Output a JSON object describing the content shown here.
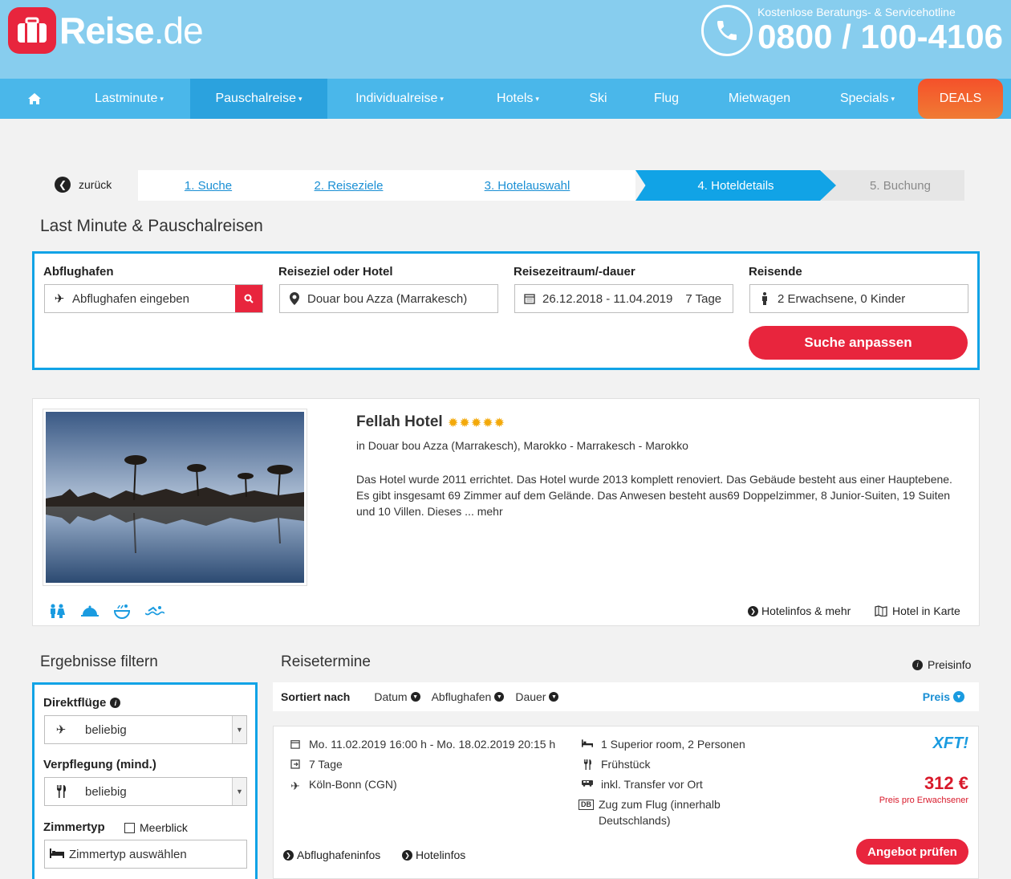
{
  "brand": {
    "name": "Reise",
    "tld": ".de",
    "red": "#e8253d",
    "blue": "#11a3e6",
    "header_blue": "#87cdee"
  },
  "hotline": {
    "label": "Kostenlose Beratungs- & Servicehotline",
    "number": "0800 / 100-4106"
  },
  "nav": {
    "items": [
      {
        "label": "Lastminute",
        "caret": "▾"
      },
      {
        "label": "Pauschalreise",
        "caret": "▾"
      },
      {
        "label": "Individualreise",
        "caret": "▾"
      },
      {
        "label": "Hotels",
        "caret": "▾"
      },
      {
        "label": "Ski",
        "caret": ""
      },
      {
        "label": "Flug",
        "caret": ""
      },
      {
        "label": "Mietwagen",
        "caret": ""
      },
      {
        "label": "Specials",
        "caret": "▾"
      }
    ],
    "active": "Pauschalreise",
    "deals": "DEALS"
  },
  "steps": {
    "back": "zurück",
    "items": [
      "1. Suche",
      "2. Reiseziele",
      "3. Hotelauswahl",
      "4. Hoteldetails",
      "5. Buchung"
    ],
    "current": "4. Hoteldetails"
  },
  "search": {
    "title": "Last Minute & Pauschalreisen",
    "departure_label": "Abflughafen",
    "departure_placeholder": "Abflughafen eingeben",
    "destination_label": "Reiseziel oder Hotel",
    "destination_value": "Douar bou Azza (Marrakesch)",
    "period_label": "Reisezeitraum/-dauer",
    "period_value": "26.12.2018 - 11.04.2019",
    "period_duration": "7 Tage",
    "travelers_label": "Reisende",
    "travelers_value": "2 Erwachsene, 0 Kinder",
    "submit": "Suche anpassen"
  },
  "hotel": {
    "name": "Fellah Hotel",
    "stars": 5,
    "location": "in Douar bou Azza (Marrakesch), Marokko - Marrakesch - Marokko",
    "description": "Das Hotel wurde 2011 errichtet. Das Hotel wurde 2013 komplett renoviert. Das Gebäude besteht aus einer Hauptebene. Es gibt insgesamt 69 Zimmer auf dem Gelände. Das Anwesen besteht aus69 Doppelzimmer, 8 Junior-Suiten, 19 Suiten und 10 Villen. Dieses ... mehr",
    "amenities": [
      "family-icon",
      "room-service-icon",
      "spa-icon",
      "swimming-icon"
    ],
    "info_link": "Hotelinfos & mehr",
    "map_link": "Hotel in Karte"
  },
  "filter": {
    "title": "Ergebnisse filtern",
    "direct_label": "Direktflüge",
    "direct_value": "beliebig",
    "board_label": "Verpflegung (mind.)",
    "board_value": "beliebig",
    "room_label": "Zimmertyp",
    "seaview_label": "Meerblick",
    "room_placeholder": "Zimmertyp auswählen"
  },
  "results": {
    "title": "Reisetermine",
    "price_info": "Preisinfo",
    "sorted_by": "Sortiert nach",
    "sort_options": [
      "Datum",
      "Abflughafen",
      "Dauer"
    ],
    "sort_active": "Preis"
  },
  "offer": {
    "dates": "Mo. 11.02.2019 16:00 h - Mo. 18.02.2019 20:15 h",
    "duration": "7 Tage",
    "airport": "Köln-Bonn (CGN)",
    "room": "1 Superior room, 2 Personen",
    "board": "Frühstück",
    "transfer": "inkl. Transfer vor Ort",
    "train": "Zug zum Flug (innerhalb Deutschlands)",
    "operator": "XFT!",
    "price": "312 €",
    "price_note": "Preis pro Erwachsener",
    "cta": "Angebot prüfen",
    "airport_info": "Abflughafeninfos",
    "hotel_info": "Hotelinfos"
  }
}
